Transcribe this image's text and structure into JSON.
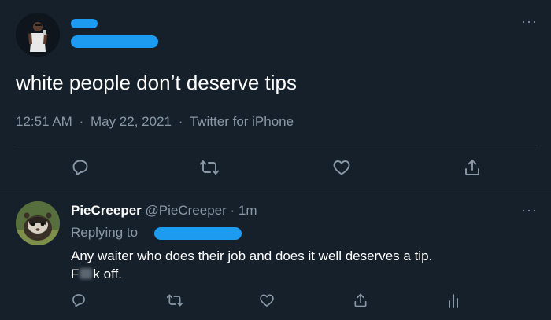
{
  "tweet": {
    "text": "white people don’t deserve tips",
    "time": "12:51 AM",
    "date": "May 22, 2021",
    "source": "Twitter for iPhone",
    "separator": "·",
    "more_label": "···"
  },
  "reply": {
    "display_name": "PieCreeper",
    "handle": "@PieCreeper",
    "separator": "·",
    "time_ago": "1m",
    "replying_label": "Replying to",
    "body_line1": "Any waiter who does their job and does it well deserves a tip.",
    "body_line2_start": "F",
    "body_line2_end": "k off.",
    "more_label": "···"
  },
  "icons": {
    "reply": "reply-icon",
    "retweet": "retweet-icon",
    "like": "heart-icon",
    "share": "share-icon",
    "analytics": "analytics-icon"
  },
  "colors": {
    "background": "#15202b",
    "redaction": "#1d9bf0",
    "secondary_text": "#8b98a5",
    "divider": "#38444d"
  }
}
